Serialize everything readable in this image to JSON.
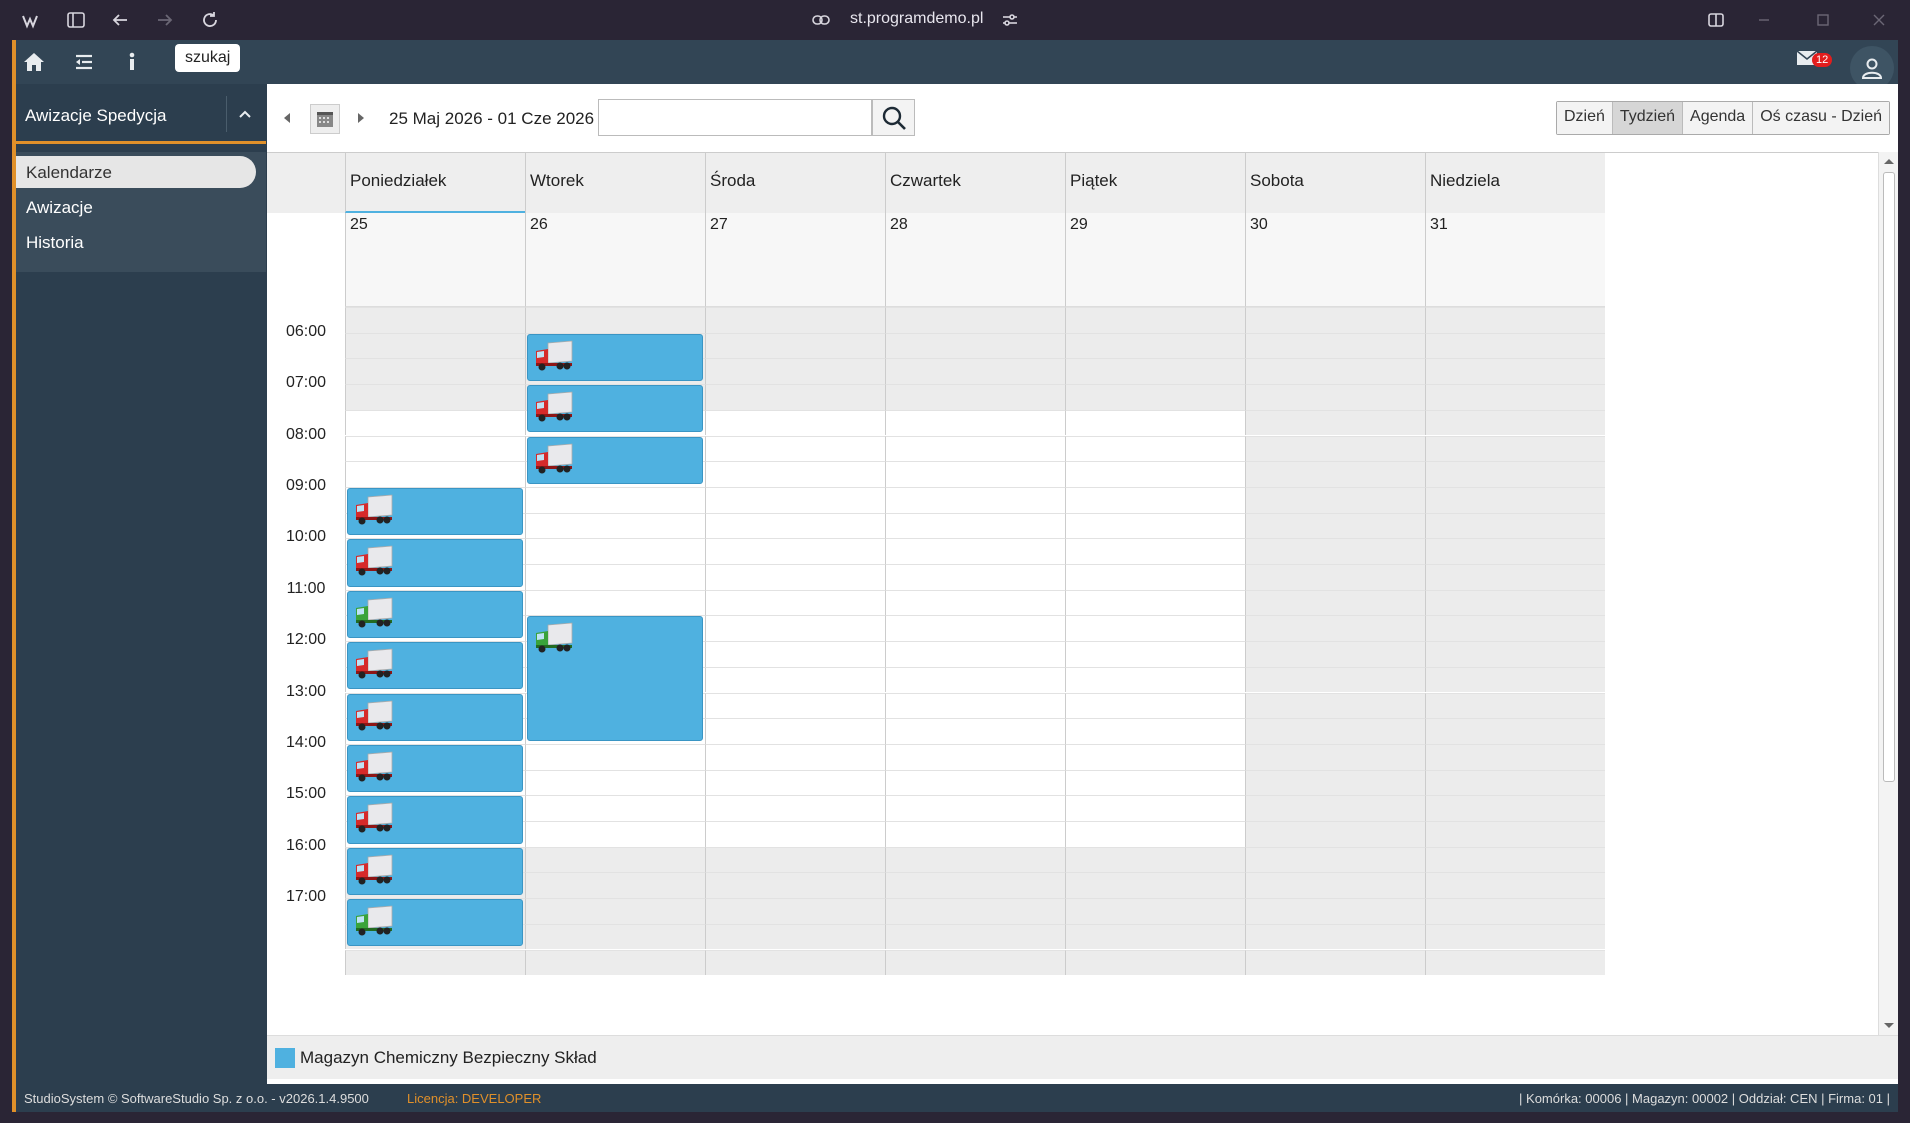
{
  "browser": {
    "url": "st.programdemo.pl"
  },
  "toolbar": {
    "search_tooltip": "szukaj",
    "mail_count": "12"
  },
  "sidebar": {
    "title": "Awizacje Spedycja",
    "items": [
      {
        "label": "Kalendarze",
        "active": true
      },
      {
        "label": "Awizacje",
        "active": false
      },
      {
        "label": "Historia",
        "active": false
      }
    ]
  },
  "calendar": {
    "date_range": "25 Maj 2026 - 01 Cze 2026",
    "search_placeholder": "",
    "views": [
      {
        "label": "Dzień",
        "active": false
      },
      {
        "label": "Tydzień",
        "active": true
      },
      {
        "label": "Agenda",
        "active": false
      },
      {
        "label": "Oś czasu - Dzień",
        "active": false
      }
    ],
    "days": [
      {
        "name": "Poniedziałek",
        "date": "25",
        "today": true
      },
      {
        "name": "Wtorek",
        "date": "26",
        "today": false
      },
      {
        "name": "Środa",
        "date": "27",
        "today": false
      },
      {
        "name": "Czwartek",
        "date": "28",
        "today": false
      },
      {
        "name": "Piątek",
        "date": "29",
        "today": false
      },
      {
        "name": "Sobota",
        "date": "30",
        "today": false
      },
      {
        "name": "Niedziela",
        "date": "31",
        "today": false
      }
    ],
    "hours": [
      "06:00",
      "07:00",
      "08:00",
      "09:00",
      "10:00",
      "11:00",
      "12:00",
      "13:00",
      "14:00",
      "15:00",
      "16:00",
      "17:00"
    ],
    "first_hour": 5.5,
    "events": [
      {
        "day": 1,
        "start": 6.0,
        "end": 7.0,
        "truck": "red"
      },
      {
        "day": 1,
        "start": 7.0,
        "end": 8.0,
        "truck": "red"
      },
      {
        "day": 1,
        "start": 8.0,
        "end": 9.0,
        "truck": "red"
      },
      {
        "day": 1,
        "start": 11.5,
        "end": 14.0,
        "truck": "green"
      },
      {
        "day": 0,
        "start": 9.0,
        "end": 10.0,
        "truck": "red"
      },
      {
        "day": 0,
        "start": 10.0,
        "end": 11.0,
        "truck": "red"
      },
      {
        "day": 0,
        "start": 11.0,
        "end": 12.0,
        "truck": "green"
      },
      {
        "day": 0,
        "start": 12.0,
        "end": 13.0,
        "truck": "red"
      },
      {
        "day": 0,
        "start": 13.0,
        "end": 14.0,
        "truck": "red"
      },
      {
        "day": 0,
        "start": 14.0,
        "end": 15.0,
        "truck": "red"
      },
      {
        "day": 0,
        "start": 15.0,
        "end": 16.0,
        "truck": "red"
      },
      {
        "day": 0,
        "start": 16.0,
        "end": 17.0,
        "truck": "red"
      },
      {
        "day": 0,
        "start": 17.0,
        "end": 18.0,
        "truck": "green"
      }
    ],
    "working_hours": {
      "weekday_start": 7.5,
      "weekday_end": 16.0
    }
  },
  "legend": {
    "label": "Magazyn Chemiczny Bezpieczny Skład",
    "color": "#4fb1e0"
  },
  "status": {
    "left": "StudioSystem © SoftwareStudio Sp. z o.o. - v2026.1.4.9500",
    "license": "Licencja: DEVELOPER",
    "right": "| Komórka: 00006 | Magazyn: 00002 | Oddział: CEN | Firma: 01 |"
  },
  "colors": {
    "accent": "#e0902a",
    "event": "#4fb1e0",
    "sidebar": "#2c3e4e"
  }
}
